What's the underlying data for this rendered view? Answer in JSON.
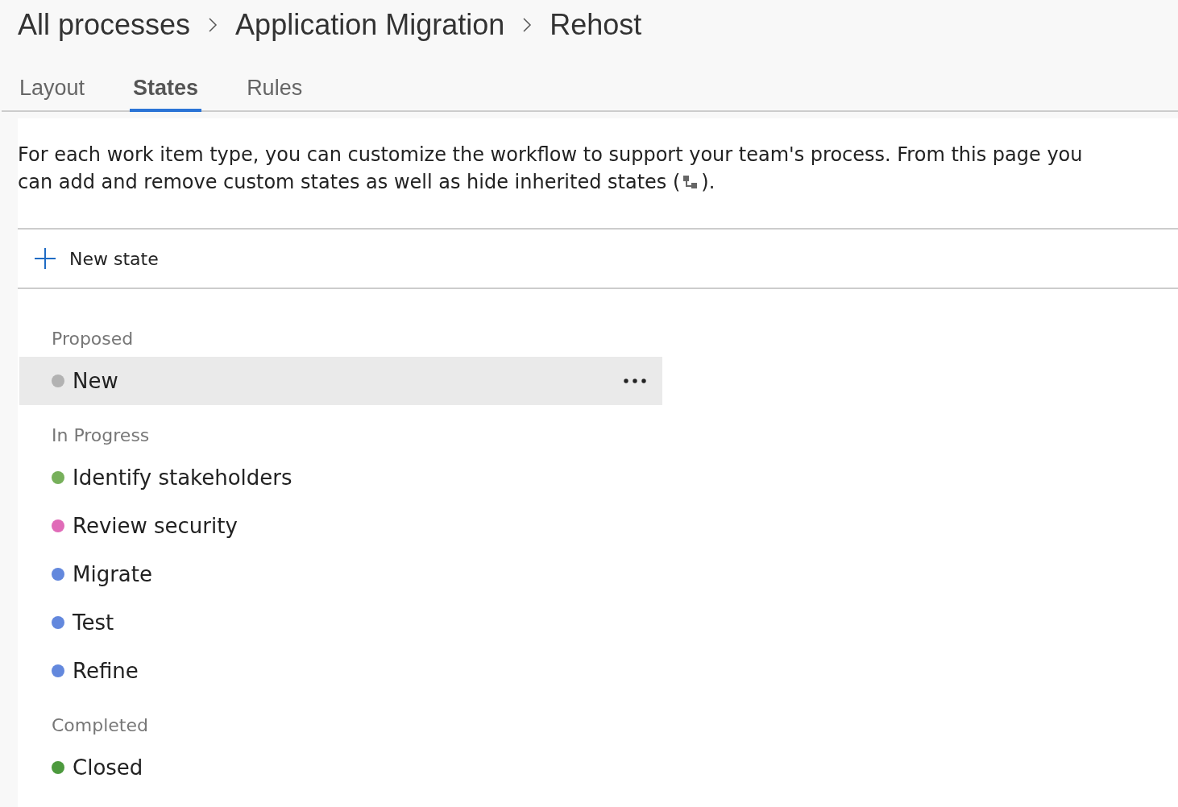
{
  "breadcrumb": [
    "All processes",
    "Application Migration",
    "Rehost"
  ],
  "tabs": [
    {
      "label": "Layout",
      "selected": false
    },
    {
      "label": "States",
      "selected": true
    },
    {
      "label": "Rules",
      "selected": false
    }
  ],
  "description": {
    "line_1": "For each work item type, you can customize the workflow to support your team's process. From this page you",
    "line_2_before": "can add and remove custom states as well as hide inherited states (",
    "line_2_after": ")."
  },
  "new_state_button": "New state",
  "groups": [
    {
      "name": "Proposed",
      "states": [
        {
          "name": "New",
          "color": "#b2b2b2",
          "selected": true
        }
      ]
    },
    {
      "name": "In Progress",
      "states": [
        {
          "name": "Identify stakeholders",
          "color": "#77b05b",
          "selected": false
        },
        {
          "name": "Review security",
          "color": "#e06bb8",
          "selected": false
        },
        {
          "name": "Migrate",
          "color": "#6388dd",
          "selected": false
        },
        {
          "name": "Test",
          "color": "#6388dd",
          "selected": false
        },
        {
          "name": "Refine",
          "color": "#6388dd",
          "selected": false
        }
      ]
    },
    {
      "name": "Completed",
      "states": [
        {
          "name": "Closed",
          "color": "#4d9a3e",
          "selected": false
        }
      ]
    }
  ]
}
